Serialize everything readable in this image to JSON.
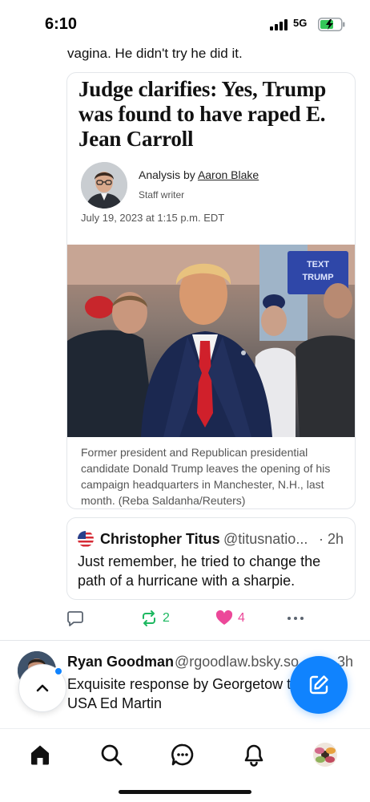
{
  "status_bar": {
    "time": "6:10",
    "network": "5G"
  },
  "post": {
    "text_tail": "vagina. He didn't try he did it."
  },
  "embed": {
    "headline": "Judge clarifies: Yes, Trump was found to have raped E. Jean Carroll",
    "byline_prefix": "Analysis by ",
    "author": "Aaron Blake",
    "role": "Staff writer",
    "date": "July 19, 2023 at 1:15 p.m. EDT",
    "photo_sign_text": "TEXT TRUMP",
    "caption": "Former president and Republican presidential candidate Donald Trump leaves the opening of his campaign headquarters in Manchester, N.H., last month. (Reba Saldanha/Reuters)"
  },
  "quote": {
    "name": "Christopher Titus",
    "handle": "@titusnatio...",
    "time": "· 2h",
    "text": "Just remember, he tried to change the path of a hurricane with a sharpie."
  },
  "actions": {
    "reposts": "2",
    "likes": "4"
  },
  "next_post": {
    "name": "Ryan Goodman",
    "handle": "@rgoodlaw.bsky.so",
    "time": "3h",
    "text": "Exquisite response by Georgetow to interim USA Ed Martin"
  },
  "colors": {
    "accent": "#1083fe",
    "repost": "#1db860",
    "like": "#ec4899"
  },
  "icons": [
    "reply-icon",
    "repost-icon",
    "heart-icon",
    "more-icon",
    "chevron-up-icon",
    "compose-icon",
    "home-icon",
    "search-icon",
    "chat-icon",
    "bell-icon"
  ]
}
